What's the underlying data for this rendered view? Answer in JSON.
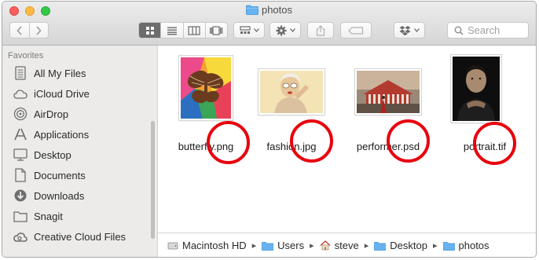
{
  "window": {
    "title": "photos"
  },
  "toolbar": {
    "back_icon": "chevron-left-icon",
    "forward_icon": "chevron-right-icon",
    "view_modes": [
      "icon-view-icon",
      "list-view-icon",
      "column-view-icon",
      "cover-flow-icon"
    ],
    "arrange_icon": "arrange-icon",
    "action_icon": "gear-icon",
    "share_icon": "share-icon",
    "tags_icon": "tag-icon",
    "dropbox_icon": "dropbox-icon",
    "search_placeholder": "Search"
  },
  "sidebar": {
    "header": "Favorites",
    "items": [
      {
        "label": "All My Files",
        "icon": "all-files-icon"
      },
      {
        "label": "iCloud Drive",
        "icon": "cloud-icon"
      },
      {
        "label": "AirDrop",
        "icon": "airdrop-icon"
      },
      {
        "label": "Applications",
        "icon": "applications-icon"
      },
      {
        "label": "Desktop",
        "icon": "desktop-icon"
      },
      {
        "label": "Documents",
        "icon": "documents-icon"
      },
      {
        "label": "Downloads",
        "icon": "downloads-icon"
      },
      {
        "label": "Snagit",
        "icon": "folder-icon"
      },
      {
        "label": "Creative Cloud Files",
        "icon": "creative-cloud-icon"
      }
    ]
  },
  "files": [
    {
      "name": "butterfly.png"
    },
    {
      "name": "fashion.jpg"
    },
    {
      "name": "performer.psd"
    },
    {
      "name": "portrait.tif"
    }
  ],
  "annotation": {
    "color": "#e8000d"
  },
  "pathbar": {
    "crumbs": [
      {
        "label": "Macintosh HD",
        "icon": "hard-drive-icon"
      },
      {
        "label": "Users",
        "icon": "folder-icon"
      },
      {
        "label": "steve",
        "icon": "home-icon"
      },
      {
        "label": "Desktop",
        "icon": "folder-icon"
      },
      {
        "label": "photos",
        "icon": "folder-icon"
      }
    ]
  }
}
